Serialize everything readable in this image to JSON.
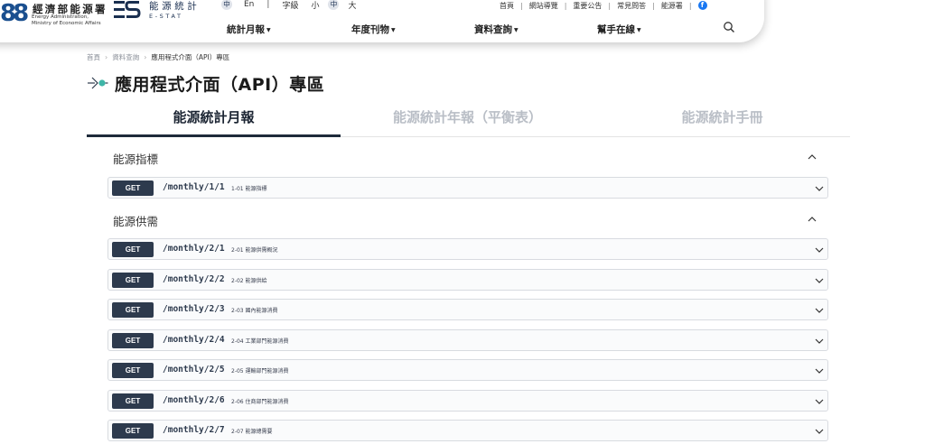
{
  "header": {
    "agency_logo": {
      "mark": "88",
      "name": "經濟部能源署",
      "en_line1": "Energy Administration,",
      "en_line2": "Ministry of Economic Affairs"
    },
    "estat_logo": {
      "name": "能源統計",
      "sub": "E-STAT"
    },
    "lang": {
      "zh": "中",
      "en": "En"
    },
    "font_size": {
      "label": "字級",
      "small": "小",
      "medium": "中",
      "large": "大"
    },
    "top_links": [
      "首頁",
      "網站導覽",
      "重要公告",
      "常見問答",
      "能源署"
    ],
    "facebook_icon": "facebook-icon",
    "nav": [
      {
        "label": "統計月報"
      },
      {
        "label": "年度刊物"
      },
      {
        "label": "資料查詢"
      },
      {
        "label": "幫手在線"
      }
    ],
    "search_icon": "search-icon"
  },
  "breadcrumb": {
    "items": [
      "首頁",
      "資料查詢",
      "應用程式介面（API）專區"
    ]
  },
  "page": {
    "title": "應用程式介面（API）專區",
    "title_icon": "api-plug-icon"
  },
  "tabs": [
    {
      "label": "能源統計月報",
      "active": true
    },
    {
      "label": "能源統計年報（平衡表）",
      "active": false
    },
    {
      "label": "能源統計手冊",
      "active": false
    }
  ],
  "sections": [
    {
      "title": "能源指標",
      "operations": [
        {
          "method": "GET",
          "path": "/monthly/1/1",
          "summary": "1-01 能源指標"
        }
      ]
    },
    {
      "title": "能源供需",
      "operations": [
        {
          "method": "GET",
          "path": "/monthly/2/1",
          "summary": "2-01 能源供需概況"
        },
        {
          "method": "GET",
          "path": "/monthly/2/2",
          "summary": "2-02 能源供給"
        },
        {
          "method": "GET",
          "path": "/monthly/2/3",
          "summary": "2-03 國內能源消費"
        },
        {
          "method": "GET",
          "path": "/monthly/2/4",
          "summary": "2-04 工業部門能源消費"
        },
        {
          "method": "GET",
          "path": "/monthly/2/5",
          "summary": "2-05 運輸部門能源消費"
        },
        {
          "method": "GET",
          "path": "/monthly/2/6",
          "summary": "2-06 住商部門能源消費"
        },
        {
          "method": "GET",
          "path": "/monthly/2/7",
          "summary": "2-07 能源總需要"
        }
      ]
    }
  ],
  "colors": {
    "method_badge": "#2d3a4d",
    "active_tab_underline": "#1e2a3a",
    "inactive_tab_text": "#b9bec6",
    "agency_logo_blue": "#1a4f8f"
  }
}
